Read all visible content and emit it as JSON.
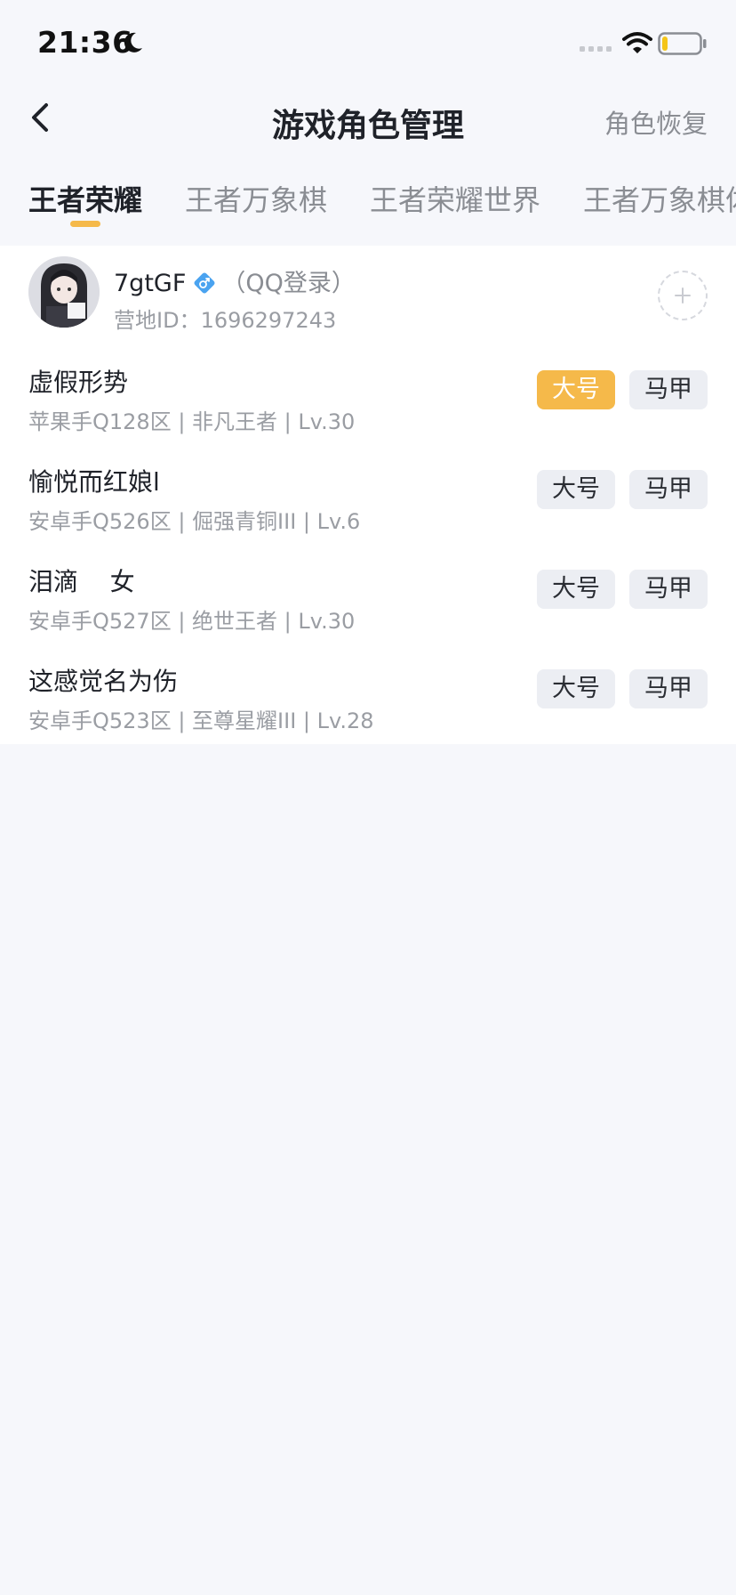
{
  "status_bar": {
    "time": "21:36",
    "icons": [
      "moon-icon",
      "signal-icon",
      "wifi-icon",
      "battery-icon"
    ],
    "battery_level_fraction": 0.15
  },
  "nav": {
    "title": "游戏角色管理",
    "restore_label": "角色恢复"
  },
  "tabs": [
    {
      "label": "王者荣耀",
      "active": true
    },
    {
      "label": "王者万象棋",
      "active": false
    },
    {
      "label": "王者荣耀世界",
      "active": false
    },
    {
      "label": "王者万象棋体",
      "active": false
    }
  ],
  "profile": {
    "name": "7gtGF",
    "gender_icon": "male-icon",
    "login_tag": "（QQ登录）",
    "id_label": "营地ID：",
    "id_value": "1696297243"
  },
  "roles": [
    {
      "name": "虚假形势",
      "meta": "苹果手Q128区 | 非凡王者 | Lv.30",
      "main_label": "大号",
      "alt_label": "马甲",
      "main_selected": true
    },
    {
      "name": "愉悦而红娘l",
      "meta": "安卓手Q526区 | 倔强青铜III | Lv.6",
      "main_label": "大号",
      "alt_label": "马甲",
      "main_selected": false
    },
    {
      "name": "泪滴    女",
      "meta": "安卓手Q527区 | 绝世王者 | Lv.30",
      "main_label": "大号",
      "alt_label": "马甲",
      "main_selected": false
    },
    {
      "name": "这感觉名为伤",
      "meta": "安卓手Q523区 | 至尊星耀III | Lv.28",
      "main_label": "大号",
      "alt_label": "马甲",
      "main_selected": false
    }
  ],
  "colors": {
    "accent": "#f5b94a",
    "background": "#f6f7fb",
    "text_primary": "#1f2229",
    "text_secondary": "#9a9da3"
  }
}
